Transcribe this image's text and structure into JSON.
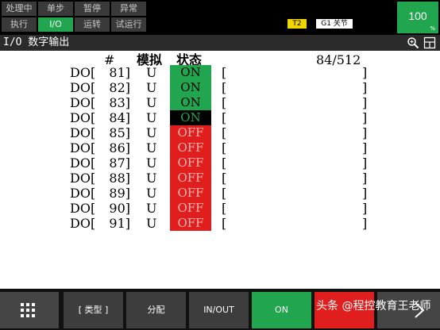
{
  "status": {
    "cells": [
      {
        "label": "处理中",
        "active": false
      },
      {
        "label": "单步",
        "active": false
      },
      {
        "label": "暂停",
        "active": false
      },
      {
        "label": "异常",
        "active": false
      },
      {
        "label": "执行",
        "active": false
      },
      {
        "label": "I/O",
        "active": true
      },
      {
        "label": "运转",
        "active": false
      },
      {
        "label": "试运行",
        "active": false
      }
    ],
    "mode": "T2",
    "group": "G1 关节",
    "override": "100",
    "override_unit": "%"
  },
  "title": "I/O 数字输出",
  "table": {
    "header_num": "#",
    "header_sim": "模拟",
    "header_status": "状态",
    "count": "84/512",
    "rows": [
      {
        "prefix": "DO[",
        "num": "81]",
        "sim": "U",
        "state": "ON",
        "cl": "[",
        "cr": "]"
      },
      {
        "prefix": "DO[",
        "num": "82]",
        "sim": "U",
        "state": "ON",
        "cl": "[",
        "cr": "]"
      },
      {
        "prefix": "DO[",
        "num": "83]",
        "sim": "U",
        "state": "ON",
        "cl": "[",
        "cr": "]"
      },
      {
        "prefix": "DO[",
        "num": "84]",
        "sim": "U",
        "state": "ON",
        "cl": "[",
        "cr": "]"
      },
      {
        "prefix": "DO[",
        "num": "85]",
        "sim": "U",
        "state": "OFF",
        "cl": "[",
        "cr": "]"
      },
      {
        "prefix": "DO[",
        "num": "86]",
        "sim": "U",
        "state": "OFF",
        "cl": "[",
        "cr": "]"
      },
      {
        "prefix": "DO[",
        "num": "87]",
        "sim": "U",
        "state": "OFF",
        "cl": "[",
        "cr": "]"
      },
      {
        "prefix": "DO[",
        "num": "88]",
        "sim": "U",
        "state": "OFF",
        "cl": "[",
        "cr": "]"
      },
      {
        "prefix": "DO[",
        "num": "89]",
        "sim": "U",
        "state": "OFF",
        "cl": "[",
        "cr": "]"
      },
      {
        "prefix": "DO[",
        "num": "90]",
        "sim": "U",
        "state": "OFF",
        "cl": "[",
        "cr": "]"
      },
      {
        "prefix": "DO[",
        "num": "91]",
        "sim": "U",
        "state": "OFF",
        "cl": "[",
        "cr": "]"
      }
    ],
    "selected_row": 3
  },
  "softkeys": {
    "menu_icon": "grid-icon",
    "type": "[ 类型 ]",
    "assign": "分配",
    "inout": "IN/OUT",
    "on": "ON",
    "off": "",
    "next_icon": "chevron-right-icon"
  },
  "watermark": "头条 @程控教育王老师",
  "colors": {
    "on": "#21a64f",
    "off": "#e01e1e",
    "selected_bg": "#000000",
    "selected_text": "#21a64f",
    "off_text": "#ffb3b3"
  }
}
